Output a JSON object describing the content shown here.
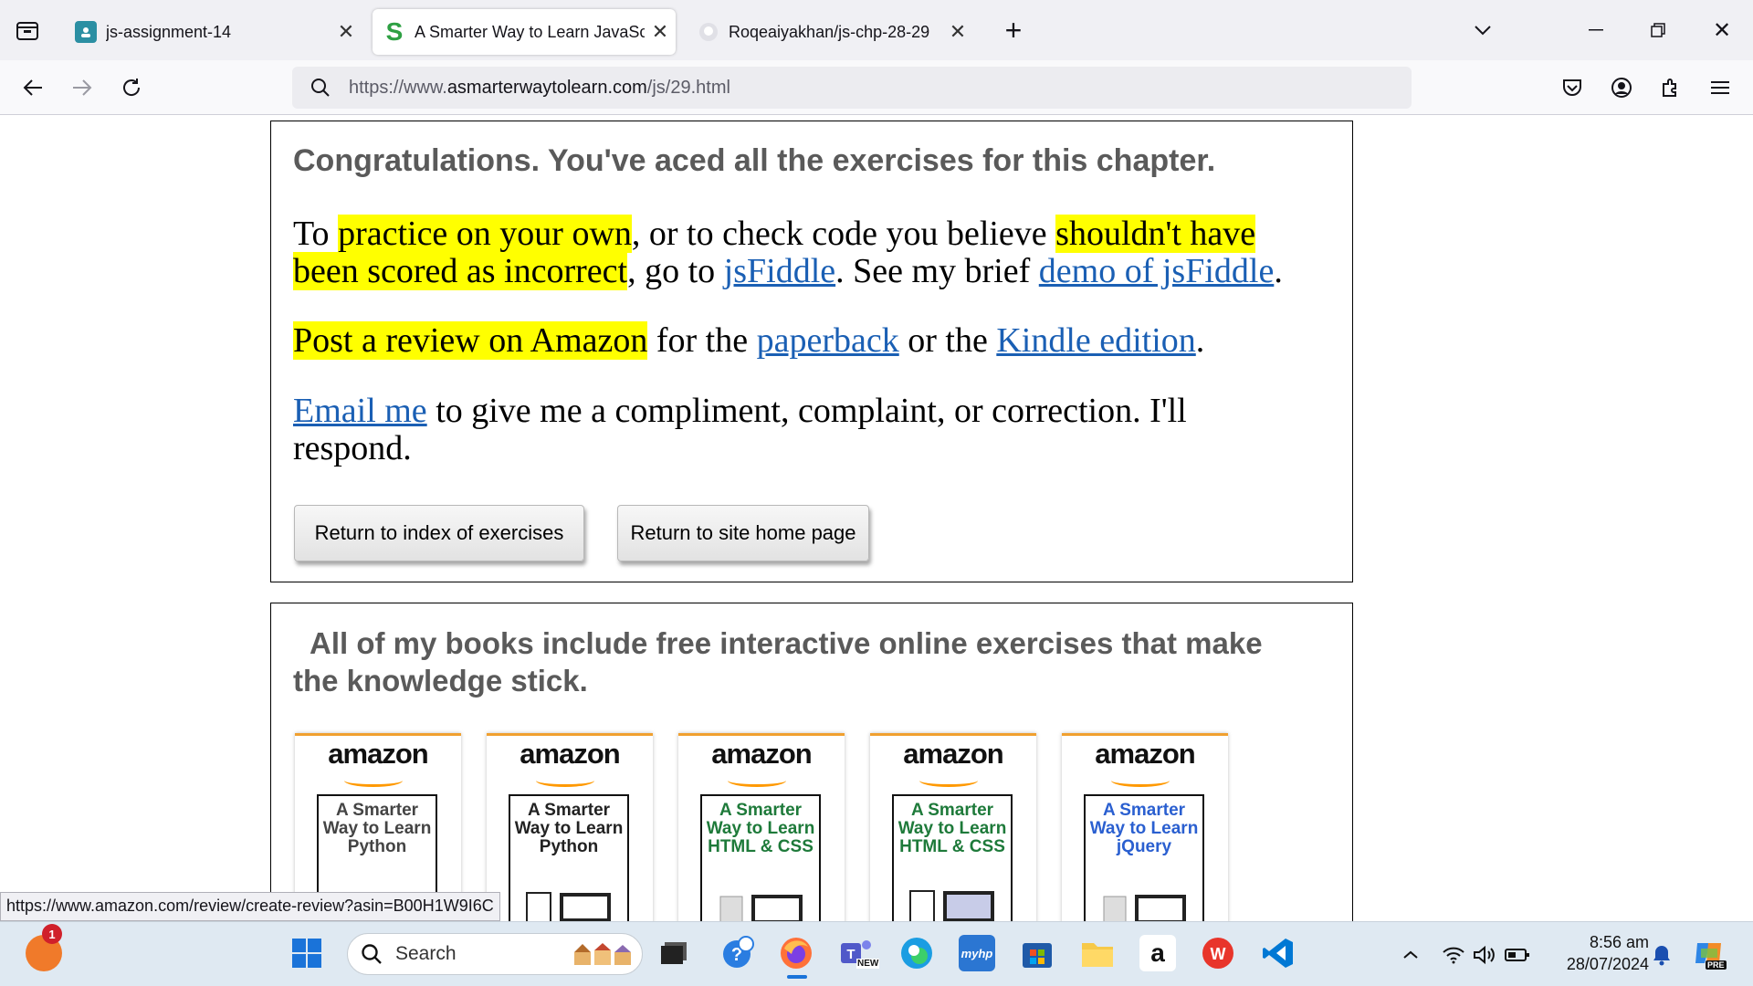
{
  "browser": {
    "tabs": [
      {
        "title": "js-assignment-14",
        "favicon": "classroom-icon"
      },
      {
        "title": "A Smarter Way to Learn JavaScr",
        "favicon": "S"
      },
      {
        "title": "Roqeaiyakhan/js-chp-28-29",
        "favicon": "github-icon"
      }
    ],
    "url_prefix": "https://www.",
    "url_domain": "asmarterwaytolearn.com",
    "url_path": "/js/29.html",
    "status_link": "https://www.amazon.com/review/create-review?asin=B00H1W9I6C"
  },
  "page": {
    "congrats": "Congratulations. You've aced all the exercises for this chapter.",
    "p1": {
      "t1": "To ",
      "h1": "practice on your own",
      "t2": ", or to check code you believe ",
      "h2": "shouldn't have",
      "h3": "been scored as incorrect",
      "t3": ", go to ",
      "l1": "jsFiddle",
      "t4": ". See my brief ",
      "l2": "demo of jsFiddle",
      "t5": "."
    },
    "p2": {
      "h1": "Post a review on Amazon",
      "t1": " for the ",
      "l1": "paperback",
      "t2": " or the ",
      "l2": "Kindle edition",
      "t3": "."
    },
    "p3": {
      "l1": "Email me",
      "t1": " to give me a compliment, complaint, or correction. I'll",
      "t2": "respond."
    },
    "buttons": {
      "index": "Return to index of exercises",
      "home": "Return to site home page"
    },
    "books_title_1": "All of my books include free interactive online exercises that make",
    "books_title_2": "the knowledge stick.",
    "books": [
      {
        "brand": "amazon",
        "title": "A Smarter Way to Learn Python",
        "color": "#444444"
      },
      {
        "brand": "amazon",
        "title": "A Smarter Way to Learn Python",
        "color": "#222222"
      },
      {
        "brand": "amazon",
        "title": "A Smarter Way to Learn HTML & CSS",
        "color": "#1e7a3a"
      },
      {
        "brand": "amazon",
        "title": "A Smarter Way to Learn HTML & CSS",
        "color": "#1e7a3a"
      },
      {
        "brand": "amazon",
        "title": "A Smarter Way to Learn jQuery",
        "color": "#2a5fd0"
      }
    ]
  },
  "taskbar": {
    "search_placeholder": "Search",
    "notification_count": "1",
    "time": "8:56 am",
    "date": "28/07/2024",
    "teams_badge": "NEW",
    "copilot_badge": "PRE",
    "myhp_label": "myhp"
  }
}
